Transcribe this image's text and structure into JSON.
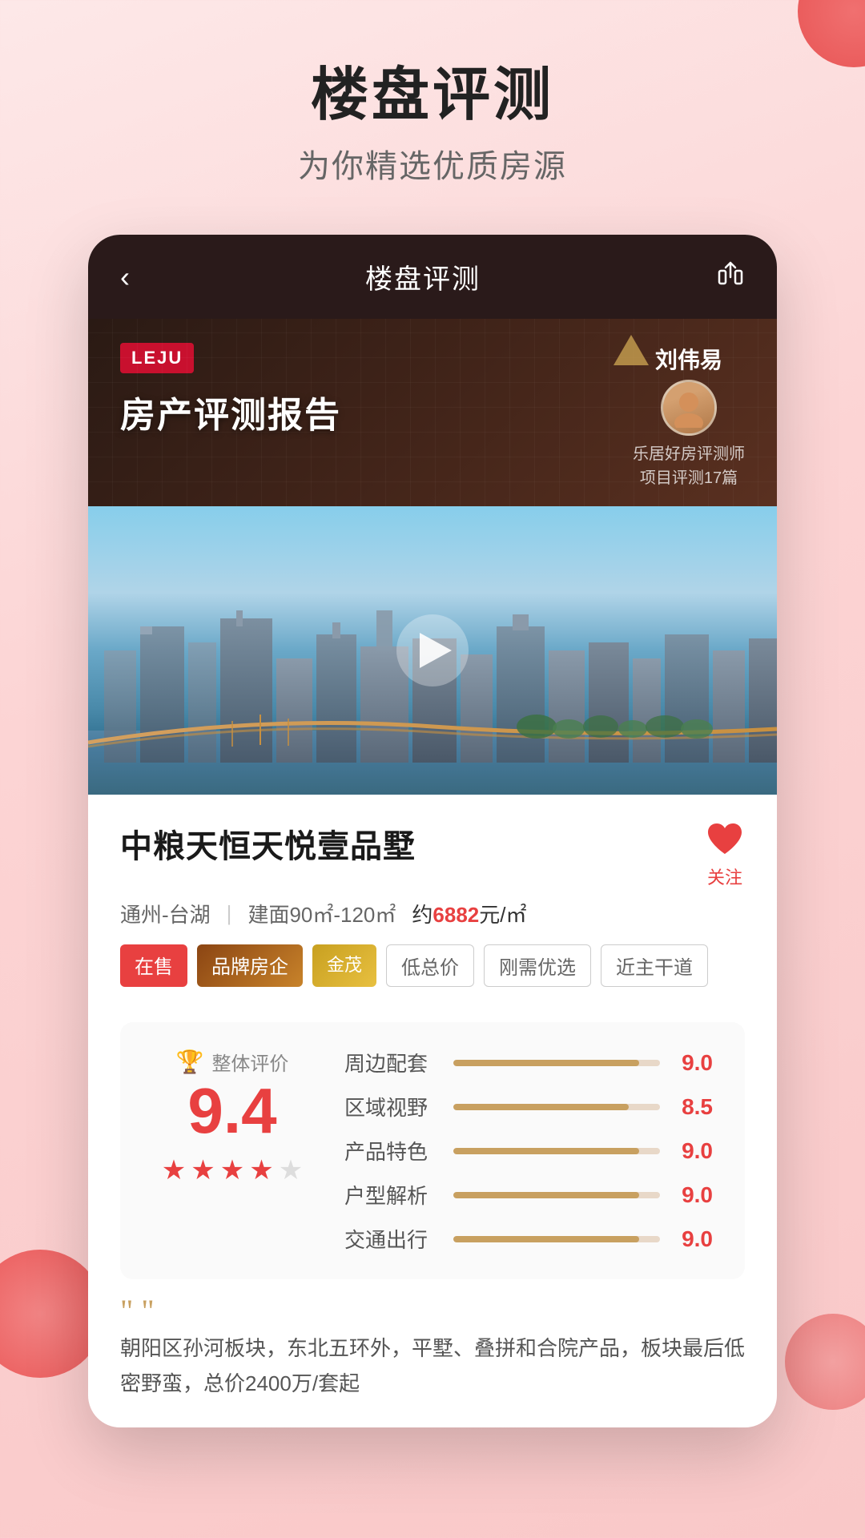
{
  "page": {
    "background": "#fce8e8"
  },
  "header": {
    "main_title": "楼盘评测",
    "subtitle": "为你精选优质房源"
  },
  "app_bar": {
    "back_label": "‹",
    "title": "楼盘评测",
    "share_icon": "share"
  },
  "report_banner": {
    "leju_label": "LEJU",
    "report_title": "房产评测报告",
    "reviewer_name": "刘伟易",
    "reviewer_desc1": "乐居好房评测师",
    "reviewer_desc2": "项目评测17篇"
  },
  "property": {
    "name": "中粮天恒天悦壹品墅",
    "location": "通州-台湖",
    "area": "建面90㎡-120㎡",
    "price": "约6882元/㎡",
    "tags": [
      {
        "label": "在售",
        "type": "sale"
      },
      {
        "label": "品牌房企",
        "type": "brand"
      },
      {
        "label": "金茂",
        "type": "jinmao"
      },
      {
        "label": "低总价",
        "type": "outline"
      },
      {
        "label": "刚需优选",
        "type": "outline"
      },
      {
        "label": "近主干道",
        "type": "outline"
      }
    ],
    "favorite_label": "关注"
  },
  "rating": {
    "overall_label": "整体评价",
    "overall_score": "9.4",
    "stars": [
      "full",
      "full",
      "full",
      "half",
      "empty"
    ],
    "scores": [
      {
        "label": "周边配套",
        "value": "9.0",
        "percent": 90
      },
      {
        "label": "区域视野",
        "value": "8.5",
        "percent": 85
      },
      {
        "label": "产品特色",
        "value": "9.0",
        "percent": 90
      },
      {
        "label": "户型解析",
        "value": "9.0",
        "percent": 90
      },
      {
        "label": "交通出行",
        "value": "9.0",
        "percent": 90
      }
    ]
  },
  "description": {
    "quote": "““",
    "text": "朝阳区孙河板块，东北五环外，平墅、叠拼和合院产品，板块最后低密野蛮，总价2400万/套起"
  }
}
